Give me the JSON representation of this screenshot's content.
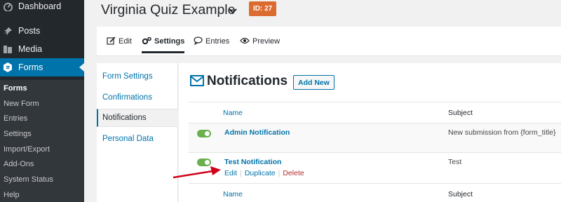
{
  "sidebar": {
    "menu": [
      {
        "label": "Dashboard",
        "icon": "dashboard-icon"
      },
      {
        "label": "Posts",
        "icon": "pushpin-icon"
      },
      {
        "label": "Media",
        "icon": "media-icon"
      },
      {
        "label": "Forms",
        "icon": "forms-icon"
      }
    ],
    "submenu": [
      "Forms",
      "New Form",
      "Entries",
      "Settings",
      "Import/Export",
      "Add-Ons",
      "System Status",
      "Help"
    ]
  },
  "header": {
    "form_title": "Virginia Quiz Example",
    "id_badge": "ID: 27"
  },
  "tabs": [
    {
      "label": "Edit",
      "icon": "edit-icon"
    },
    {
      "label": "Settings",
      "icon": "gears-icon"
    },
    {
      "label": "Entries",
      "icon": "speech-bubble-icon"
    },
    {
      "label": "Preview",
      "icon": "eye-icon"
    }
  ],
  "settings_nav": [
    "Form Settings",
    "Confirmations",
    "Notifications",
    "Personal Data"
  ],
  "notifications": {
    "title": "Notifications",
    "add_new": "Add New",
    "columns": {
      "name": "Name",
      "subject": "Subject"
    },
    "rows": [
      {
        "name": "Admin Notification",
        "subject": "New submission from {form_title}",
        "active": true
      },
      {
        "name": "Test Notification",
        "subject": "Test",
        "active": true,
        "actions": {
          "edit": "Edit",
          "duplicate": "Duplicate",
          "delete": "Delete"
        }
      }
    ]
  },
  "colors": {
    "sidebar_bg": "#23282d",
    "accent": "#0073aa",
    "badge": "#dc6b2f",
    "toggle_on": "#6ab04c",
    "delete": "#b32d2e",
    "arrow": "#d0021b"
  }
}
